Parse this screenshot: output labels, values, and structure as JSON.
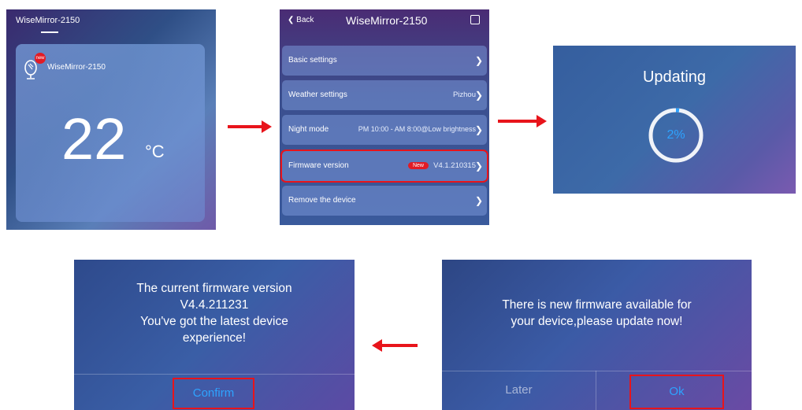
{
  "home": {
    "device_title": "WiseMirror-2150",
    "card_device_name": "WiseMirror-2150",
    "new_badge": "new",
    "temperature": "22",
    "unit": "°C"
  },
  "settings": {
    "back_label": "Back",
    "title": "WiseMirror-2150",
    "rows": [
      {
        "label": "Basic settings",
        "value": ""
      },
      {
        "label": "Weather settings",
        "value": "Pizhou"
      },
      {
        "label": "Night mode",
        "value": "PM 10:00 - AM 8:00@Low brightness"
      },
      {
        "label": "Firmware version",
        "value": "V4.1.210315",
        "badge": "New"
      },
      {
        "label": "Remove the device",
        "value": ""
      }
    ]
  },
  "updating": {
    "title": "Updating",
    "percent": "2%",
    "progress": 0.02
  },
  "latest_dialog": {
    "line1": "The current firmware version",
    "line2": "V4.4.211231",
    "line3": "You've got the latest device",
    "line4": "experience!",
    "confirm_label": "Confirm"
  },
  "update_dialog": {
    "line1": "There is new firmware available for",
    "line2": "your device,please update now!",
    "later_label": "Later",
    "ok_label": "Ok"
  },
  "colors": {
    "arrow": "#e8141b",
    "highlight": "#e8141b",
    "accent": "#2ea3ff"
  }
}
